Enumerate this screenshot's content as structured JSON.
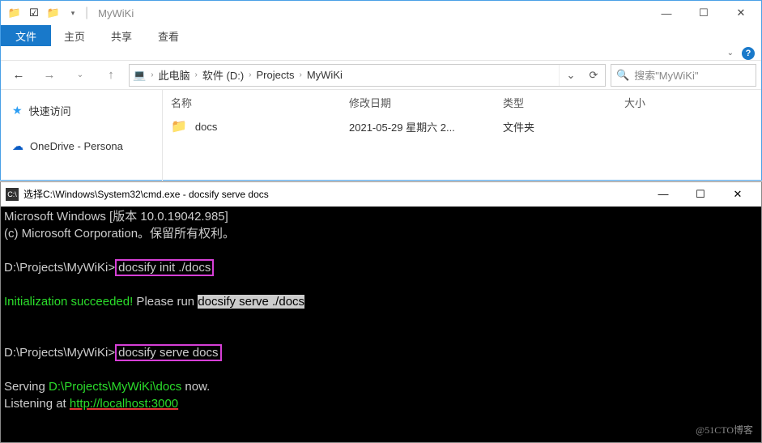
{
  "explorer": {
    "title": "MyWiKi",
    "tabs": {
      "file": "文件",
      "home": "主页",
      "share": "共享",
      "view": "查看"
    },
    "breadcrumb": [
      "此电脑",
      "软件 (D:)",
      "Projects",
      "MyWiKi"
    ],
    "search_placeholder": "搜索\"MyWiKi\"",
    "sidebar": {
      "quick": "快速访问",
      "onedrive": "OneDrive - Persona"
    },
    "columns": {
      "name": "名称",
      "date": "修改日期",
      "type": "类型",
      "size": "大小"
    },
    "rows": [
      {
        "name": "docs",
        "date": "2021-05-29 星期六 2...",
        "type": "文件夹"
      }
    ]
  },
  "cmd": {
    "title": "选择C:\\Windows\\System32\\cmd.exe - docsify  serve docs",
    "line1": "Microsoft Windows [版本 10.0.19042.985]",
    "line2": "(c) Microsoft Corporation。保留所有权利。",
    "prompt": "D:\\Projects\\MyWiKi>",
    "cmd1": "docsify init ./docs",
    "init_success": "Initialization succeeded!",
    "init_tail": " Please run ",
    "init_hl": "docsify serve ./docs",
    "cmd2": "docsify serve docs",
    "serve1a": "Serving ",
    "serve1b": "D:\\Projects\\MyWiKi\\docs",
    "serve1c": " now.",
    "listen_a": "Listening at ",
    "listen_b": "http://localhost:3000"
  },
  "watermark": "@51CTO博客"
}
